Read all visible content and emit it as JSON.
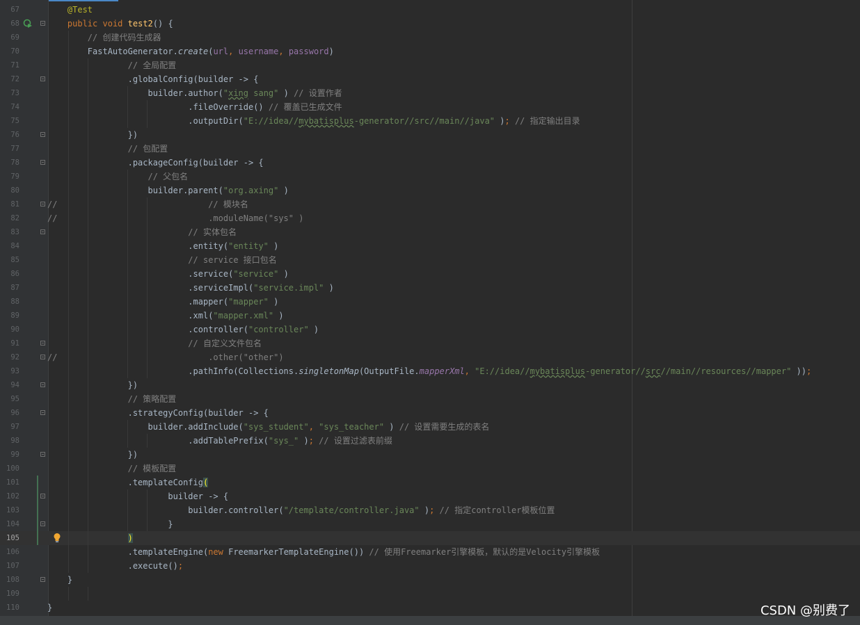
{
  "editor": {
    "language": "Java",
    "current_line": 105
  },
  "lines": [
    {
      "n": "67",
      "tokens": [
        [
          "    ",
          ""
        ],
        [
          "@Test",
          "ann"
        ]
      ]
    },
    {
      "n": "68",
      "tokens": [
        [
          "    ",
          ""
        ],
        [
          "public",
          "kw"
        ],
        [
          " ",
          ""
        ],
        [
          "void",
          "kw"
        ],
        [
          " ",
          ""
        ],
        [
          "test2",
          "fn"
        ],
        [
          "() {",
          ""
        ]
      ]
    },
    {
      "n": "69",
      "tokens": [
        [
          "        ",
          ""
        ],
        [
          "// 创建代码生成器",
          "cmt"
        ]
      ]
    },
    {
      "n": "70",
      "tokens": [
        [
          "        FastAutoGenerator.",
          ""
        ],
        [
          "create",
          "it"
        ],
        [
          "(",
          ""
        ],
        [
          "url",
          "par"
        ],
        [
          ", ",
          "kw"
        ],
        [
          "username",
          "par"
        ],
        [
          ", ",
          "kw"
        ],
        [
          "password",
          "par"
        ],
        [
          ")",
          ""
        ]
      ]
    },
    {
      "n": "71",
      "tokens": [
        [
          "                ",
          ""
        ],
        [
          "// 全局配置",
          "cmt"
        ]
      ]
    },
    {
      "n": "72",
      "tokens": [
        [
          "                .globalConfig(builder -> {",
          ""
        ]
      ]
    },
    {
      "n": "73",
      "tokens": [
        [
          "                    builder.author(",
          ""
        ],
        [
          "\"",
          "str"
        ],
        [
          "xing",
          "str squig"
        ],
        [
          " sang\"",
          "str"
        ],
        [
          " ) ",
          ""
        ],
        [
          "// 设置作者",
          "cmt"
        ]
      ]
    },
    {
      "n": "74",
      "tokens": [
        [
          "                            .fileOverride() ",
          ""
        ],
        [
          "// 覆盖已生成文件",
          "cmt"
        ]
      ]
    },
    {
      "n": "75",
      "tokens": [
        [
          "                            .outputDir(",
          ""
        ],
        [
          "\"E://idea//",
          "str"
        ],
        [
          "mybatisplus",
          "str squig"
        ],
        [
          "-generator//src//main//java\"",
          "str"
        ],
        [
          " )",
          ""
        ],
        [
          "; ",
          "kw"
        ],
        [
          "// 指定输出目录",
          "cmt"
        ]
      ]
    },
    {
      "n": "76",
      "tokens": [
        [
          "                })",
          ""
        ]
      ]
    },
    {
      "n": "77",
      "tokens": [
        [
          "                ",
          ""
        ],
        [
          "// 包配置",
          "cmt"
        ]
      ]
    },
    {
      "n": "78",
      "tokens": [
        [
          "                .packageConfig(builder -> {",
          ""
        ]
      ]
    },
    {
      "n": "79",
      "tokens": [
        [
          "                    ",
          ""
        ],
        [
          "// 父包名",
          "cmt"
        ]
      ]
    },
    {
      "n": "80",
      "tokens": [
        [
          "                    builder.parent(",
          ""
        ],
        [
          "\"org.axing\"",
          "str"
        ],
        [
          " )",
          ""
        ]
      ]
    },
    {
      "n": "81",
      "tokens": [
        [
          "//                              // 模块名",
          "cmt"
        ]
      ]
    },
    {
      "n": "82",
      "tokens": [
        [
          "//                              .moduleName(\"sys\" )",
          "cmt"
        ]
      ]
    },
    {
      "n": "83",
      "tokens": [
        [
          "                            ",
          ""
        ],
        [
          "// 实体包名",
          "cmt"
        ]
      ]
    },
    {
      "n": "84",
      "tokens": [
        [
          "                            .entity(",
          ""
        ],
        [
          "\"entity\"",
          "str"
        ],
        [
          " )",
          ""
        ]
      ]
    },
    {
      "n": "85",
      "tokens": [
        [
          "                            ",
          ""
        ],
        [
          "// service 接口包名",
          "cmt"
        ]
      ]
    },
    {
      "n": "86",
      "tokens": [
        [
          "                            .service(",
          ""
        ],
        [
          "\"service\"",
          "str"
        ],
        [
          " )",
          ""
        ]
      ]
    },
    {
      "n": "87",
      "tokens": [
        [
          "                            .serviceImpl(",
          ""
        ],
        [
          "\"service.impl\"",
          "str"
        ],
        [
          " )",
          ""
        ]
      ]
    },
    {
      "n": "88",
      "tokens": [
        [
          "                            .mapper(",
          ""
        ],
        [
          "\"mapper\"",
          "str"
        ],
        [
          " )",
          ""
        ]
      ]
    },
    {
      "n": "89",
      "tokens": [
        [
          "                            .xml(",
          ""
        ],
        [
          "\"mapper.xml\"",
          "str"
        ],
        [
          " )",
          ""
        ]
      ]
    },
    {
      "n": "90",
      "tokens": [
        [
          "                            .controller(",
          ""
        ],
        [
          "\"controller\"",
          "str"
        ],
        [
          " )",
          ""
        ]
      ]
    },
    {
      "n": "91",
      "tokens": [
        [
          "                            ",
          ""
        ],
        [
          "// 自定义文件包名",
          "cmt"
        ]
      ]
    },
    {
      "n": "92",
      "tokens": [
        [
          "//                              .other(\"other\")",
          "cmt"
        ]
      ]
    },
    {
      "n": "93",
      "tokens": [
        [
          "                            .pathInfo(Collections.",
          ""
        ],
        [
          "singletonMap",
          "it"
        ],
        [
          "(OutputFile.",
          ""
        ],
        [
          "mapperXml",
          "sfield"
        ],
        [
          ", ",
          "kw"
        ],
        [
          "\"E://idea//",
          "str"
        ],
        [
          "mybatisplus",
          "str squig"
        ],
        [
          "-generator//",
          "str"
        ],
        [
          "src",
          "str squig"
        ],
        [
          "//main//resources//mapper\"",
          "str"
        ],
        [
          " ))",
          ""
        ],
        [
          ";",
          "kw"
        ]
      ]
    },
    {
      "n": "94",
      "tokens": [
        [
          "                })",
          ""
        ]
      ]
    },
    {
      "n": "95",
      "tokens": [
        [
          "                ",
          ""
        ],
        [
          "// 策略配置",
          "cmt"
        ]
      ]
    },
    {
      "n": "96",
      "tokens": [
        [
          "                .strategyConfig(builder -> {",
          ""
        ]
      ]
    },
    {
      "n": "97",
      "tokens": [
        [
          "                    builder.addInclude(",
          ""
        ],
        [
          "\"sys_student\"",
          "str"
        ],
        [
          ", ",
          "kw"
        ],
        [
          "\"sys_teacher\"",
          "str"
        ],
        [
          " ) ",
          ""
        ],
        [
          "// 设置需要生成的表名",
          "cmt"
        ]
      ]
    },
    {
      "n": "98",
      "tokens": [
        [
          "                            .addTablePrefix(",
          ""
        ],
        [
          "\"sys_\"",
          "str"
        ],
        [
          " )",
          ""
        ],
        [
          "; ",
          "kw"
        ],
        [
          "// 设置过滤表前缀",
          "cmt"
        ]
      ]
    },
    {
      "n": "99",
      "tokens": [
        [
          "                })",
          ""
        ]
      ]
    },
    {
      "n": "100",
      "tokens": [
        [
          "                ",
          ""
        ],
        [
          "// 模板配置",
          "cmt"
        ]
      ]
    },
    {
      "n": "101",
      "tokens": [
        [
          "                .templateConfig",
          ""
        ],
        [
          "(",
          "brace-hl"
        ]
      ]
    },
    {
      "n": "102",
      "tokens": [
        [
          "                        builder -> {",
          ""
        ]
      ]
    },
    {
      "n": "103",
      "tokens": [
        [
          "                            builder.controller(",
          ""
        ],
        [
          "\"/template/controller.java\"",
          "str"
        ],
        [
          " )",
          ""
        ],
        [
          "; ",
          "kw"
        ],
        [
          "// 指定controller模板位置",
          "cmt"
        ]
      ]
    },
    {
      "n": "104",
      "tokens": [
        [
          "                        }",
          ""
        ]
      ]
    },
    {
      "n": "105",
      "tokens": [
        [
          "                ",
          ""
        ],
        [
          ")",
          "brace-hl"
        ]
      ]
    },
    {
      "n": "106",
      "tokens": [
        [
          "                .templateEngine(",
          ""
        ],
        [
          "new",
          "kw"
        ],
        [
          " FreemarkerTemplateEngine()) ",
          ""
        ],
        [
          "// 使用Freemarker引擎模板，默认的是Velocity引擎模板",
          "cmt"
        ]
      ]
    },
    {
      "n": "107",
      "tokens": [
        [
          "                .execute()",
          ""
        ],
        [
          ";",
          "kw"
        ]
      ]
    },
    {
      "n": "108",
      "tokens": [
        [
          "    }",
          ""
        ]
      ]
    },
    {
      "n": "109",
      "tokens": []
    },
    {
      "n": "110",
      "tokens": [
        [
          "}",
          ""
        ]
      ]
    }
  ],
  "gutter": {
    "run_icon_line": "68",
    "bulb_icon_line": "105",
    "fold_lines": [
      "68",
      "72",
      "76",
      "78",
      "81",
      "83",
      "91",
      "92",
      "94",
      "96",
      "99",
      "102",
      "104",
      "108"
    ],
    "changed_lines": [
      "101",
      "102",
      "103",
      "104",
      "105"
    ]
  },
  "watermark": {
    "text": "CSDN @别费了"
  },
  "colors": {
    "background": "#2b2b2b",
    "keyword": "#cc7832",
    "annotation": "#bbb529",
    "method_decl": "#ffc66d",
    "string": "#6a8759",
    "comment": "#808080",
    "parameter": "#9876aa"
  }
}
